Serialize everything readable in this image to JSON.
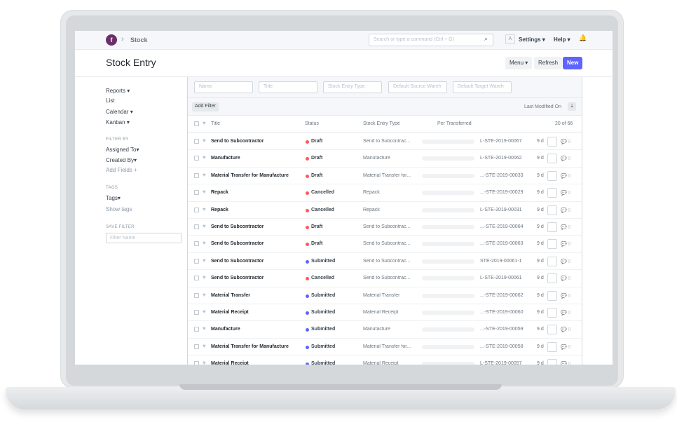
{
  "navbar": {
    "logo": "f",
    "breadcrumb": "Stock",
    "search_placeholder": "Search or type a command (Ctrl + G)",
    "avatar_letter": "A",
    "settings": "Settings",
    "help": "Help"
  },
  "page": {
    "title": "Stock Entry",
    "menu_btn": "Menu",
    "refresh_btn": "Refresh",
    "new_btn": "New"
  },
  "sidebar": {
    "reports": "Reports",
    "list": "List",
    "calendar": "Calendar",
    "kanban": "Kanban",
    "filter_by": "FILTER BY",
    "assigned_to": "Assigned To",
    "created_by": "Created By",
    "add_fields": "Add Fields",
    "tags_heading": "TAGS",
    "tags": "Tags",
    "show_tags": "Show tags",
    "save_filter": "SAVE FILTER",
    "filter_name_placeholder": "Filter Name"
  },
  "filters": {
    "name": "Name",
    "title": "Title",
    "stock_entry_type": "Stock Entry Type",
    "default_source": "Default Source Wareh",
    "default_target": "Default Target Wareh",
    "add_filter": "Add Filter",
    "sort_label": "Last Modified On"
  },
  "columns": {
    "title": "Title",
    "status": "Status",
    "type": "Stock Entry Type",
    "per_transferred": "Per Transferred",
    "count": "20 of 66"
  },
  "status_colors": {
    "Draft": "#ff5858",
    "Cancelled": "#ff5858",
    "Submitted": "#5e64ff"
  },
  "rows": [
    {
      "title": "Send to Subcontractor",
      "status": "Draft",
      "type": "Send to Subcontrac...",
      "name": "L-STE-2019-00067",
      "age": "9 d",
      "comments": "0",
      "per_transferred": 0
    },
    {
      "title": "Manufacture",
      "status": "Draft",
      "type": "Manufacture",
      "name": "L-STE-2019-00062",
      "age": "9 d",
      "comments": "0",
      "per_transferred": 0
    },
    {
      "title": "Material Transfer for Manufacture",
      "status": "Draft",
      "type": "Material Transfer for...",
      "name": "...-STE-2019-00033",
      "age": "9 d",
      "comments": "0",
      "per_transferred": 0
    },
    {
      "title": "Repack",
      "status": "Cancelled",
      "type": "Repack",
      "name": "...-STE-2019-00029",
      "age": "9 d",
      "comments": "0",
      "per_transferred": 0
    },
    {
      "title": "Repack",
      "status": "Cancelled",
      "type": "Repack",
      "name": "L-STE-2019-00031",
      "age": "9 d",
      "comments": "0",
      "per_transferred": 0
    },
    {
      "title": "Send to Subcontractor",
      "status": "Draft",
      "type": "Send to Subcontrac...",
      "name": "...-STE-2019-00064",
      "age": "9 d",
      "comments": "0",
      "per_transferred": 0
    },
    {
      "title": "Send to Subcontractor",
      "status": "Draft",
      "type": "Send to Subcontrac...",
      "name": "...-STE-2019-00063",
      "age": "9 d",
      "comments": "0",
      "per_transferred": 0
    },
    {
      "title": "Send to Subcontractor",
      "status": "Submitted",
      "type": "Send to Subcontrac...",
      "name": "STE-2019-00061-1",
      "age": "9 d",
      "comments": "0",
      "per_transferred": 0
    },
    {
      "title": "Send to Subcontractor",
      "status": "Cancelled",
      "type": "Send to Subcontrac...",
      "name": "L-STE-2019-00061",
      "age": "9 d",
      "comments": "0",
      "per_transferred": 0
    },
    {
      "title": "Material Transfer",
      "status": "Submitted",
      "type": "Material Transfer",
      "name": "...-STE-2019-00062",
      "age": "9 d",
      "comments": "0",
      "per_transferred": 0
    },
    {
      "title": "Material Receipt",
      "status": "Submitted",
      "type": "Material Receipt",
      "name": "...-STE-2019-00060",
      "age": "9 d",
      "comments": "0",
      "per_transferred": 0
    },
    {
      "title": "Manufacture",
      "status": "Submitted",
      "type": "Manufacture",
      "name": "...-STE-2019-00059",
      "age": "9 d",
      "comments": "0",
      "per_transferred": 0
    },
    {
      "title": "Material Transfer for Manufacture",
      "status": "Submitted",
      "type": "Material Transfer for...",
      "name": "...-STE-2019-00058",
      "age": "9 d",
      "comments": "0",
      "per_transferred": 0
    },
    {
      "title": "Material Receipt",
      "status": "Submitted",
      "type": "Material Receipt",
      "name": "L-STE-2019-00057",
      "age": "9 d",
      "comments": "0",
      "per_transferred": 0
    }
  ]
}
